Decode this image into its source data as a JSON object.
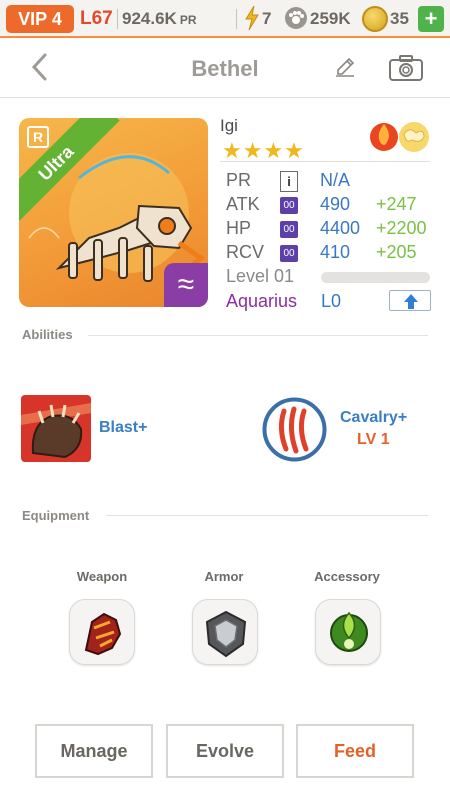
{
  "status_bar": {
    "vip": "VIP 4",
    "level": "L67",
    "power": "924.6K",
    "power_suffix": "PR",
    "energy": "7",
    "food": "259K",
    "gold": "35",
    "add_label": "+"
  },
  "header": {
    "title": "Bethel"
  },
  "card": {
    "rarity_badge": "R",
    "grade": "Ultra",
    "element_symbol": "≈"
  },
  "monster": {
    "name": "Igi",
    "stars": "★★★★",
    "stars_count": 4,
    "stats": [
      {
        "label": "PR",
        "tag": "i",
        "value": "N/A",
        "bonus": ""
      },
      {
        "label": "ATK",
        "tag": "00",
        "value": "490",
        "bonus": "+247"
      },
      {
        "label": "HP",
        "tag": "00",
        "value": "4400",
        "bonus": "+2200"
      },
      {
        "label": "RCV",
        "tag": "00",
        "value": "410",
        "bonus": "+205"
      }
    ],
    "level": "Level 01",
    "level_progress": 0,
    "sign": "Aquarius",
    "sign_level": "L0"
  },
  "abilities": {
    "title": "Abilities",
    "items": [
      {
        "name": "Blast+",
        "level": ""
      },
      {
        "name": "Cavalry+",
        "level": "LV 1"
      }
    ]
  },
  "equipment": {
    "title": "Equipment",
    "slots": [
      {
        "label": "Weapon"
      },
      {
        "label": "Armor"
      },
      {
        "label": "Accessory"
      }
    ]
  },
  "actions": {
    "manage": "Manage",
    "evolve": "Evolve",
    "feed": "Feed"
  },
  "colors": {
    "accent_orange": "#ee6a2b",
    "stat_blue": "#3a78c4",
    "bonus_green": "#79c244",
    "sign_purple": "#8b2ea3",
    "feed_orange": "#e4622a"
  }
}
